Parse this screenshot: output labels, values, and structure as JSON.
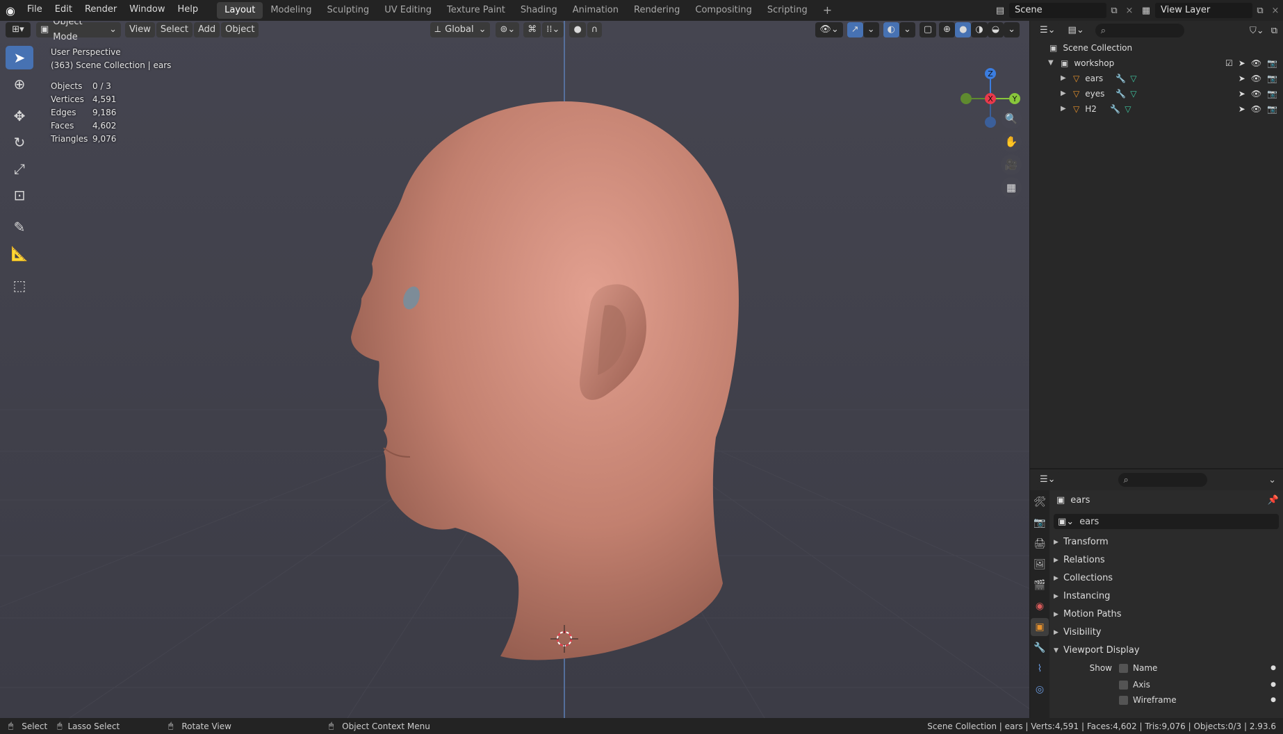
{
  "topbar": {
    "menus": [
      "File",
      "Edit",
      "Render",
      "Window",
      "Help"
    ],
    "workspaces": [
      "Layout",
      "Modeling",
      "Sculpting",
      "UV Editing",
      "Texture Paint",
      "Shading",
      "Animation",
      "Rendering",
      "Compositing",
      "Scripting"
    ],
    "active_workspace": "Layout",
    "add_tab": "+",
    "scene": "Scene",
    "view_layer": "View Layer"
  },
  "viewport": {
    "mode": "Object Mode",
    "menus": [
      "View",
      "Select",
      "Add",
      "Object"
    ],
    "orientation": "Global",
    "info": {
      "perspective": "User Perspective",
      "collection_line": "(363) Scene Collection | ears",
      "stats": [
        {
          "label": "Objects",
          "value": "0 / 3"
        },
        {
          "label": "Vertices",
          "value": "4,591"
        },
        {
          "label": "Edges",
          "value": "9,186"
        },
        {
          "label": "Faces",
          "value": "4,602"
        },
        {
          "label": "Triangles",
          "value": "9,076"
        }
      ]
    },
    "gizmo": {
      "x": "X",
      "y": "Y",
      "z": "Z"
    }
  },
  "outliner": {
    "root": "Scene Collection",
    "collection": "workshop",
    "objects": [
      "ears",
      "eyes",
      "H2"
    ]
  },
  "properties": {
    "object_name": "ears",
    "data_name": "ears",
    "panels": [
      "Transform",
      "Relations",
      "Collections",
      "Instancing",
      "Motion Paths",
      "Visibility",
      "Viewport Display"
    ],
    "show_label": "Show",
    "show_options": [
      "Name",
      "Axis",
      "Wireframe"
    ]
  },
  "statusbar": {
    "select": "Select",
    "lasso": "Lasso Select",
    "rotate": "Rotate View",
    "context": "Object Context Menu",
    "right": "Scene Collection | ears | Verts:4,591 | Faces:4,602 | Tris:9,076 | Objects:0/3 | 2.93.6"
  },
  "colors": {
    "accent": "#4772b3",
    "skin": "#c88a78",
    "x_axis": "#e8394b",
    "y_axis": "#88c63b",
    "z_axis": "#3b7de0"
  }
}
